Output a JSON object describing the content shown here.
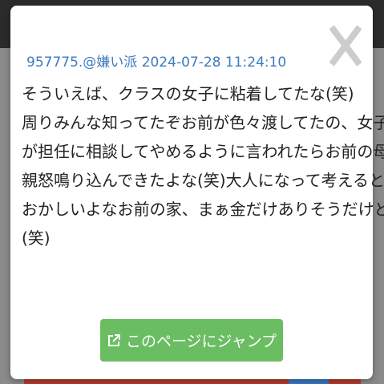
{
  "post": {
    "meta": "957775.@嫌い派 2024-07-28 11:24:10",
    "lines": [
      "そういえば、クラスの女子に粘着してたな(笑)",
      "周りみんな知ってたぞお前が色々渡してたの、女子",
      "が担任に相談してやめるように言われたらお前の母",
      "親怒鳴り込んできたよな(笑)大人になって考えると",
      "おかしいよなお前の家、まぁ金だけありそうだけど",
      "(笑)"
    ]
  },
  "actions": {
    "jump_label": "このページにジャンプ"
  },
  "icons": {
    "close": "close-icon",
    "jump": "external-link-icon"
  },
  "colors": {
    "meta": "#3d7bbf",
    "button": "#6bbd62",
    "close": "#cccccc"
  }
}
